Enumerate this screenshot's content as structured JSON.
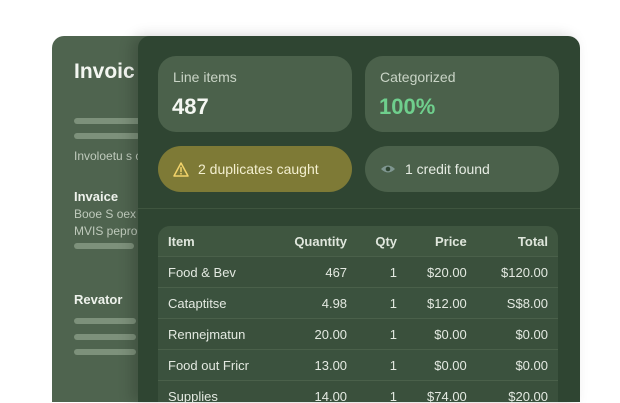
{
  "background_panel": {
    "title": "Invoic",
    "subtitle": "Involoetu s c",
    "section1_heading": "Invaice",
    "section1_line1": "Booe S oex",
    "section1_line2": "MVIS pepro",
    "section2_heading": "Revator"
  },
  "stats": {
    "line_items_label": "Line items",
    "line_items_value": "487",
    "categorized_label": "Categorized",
    "categorized_value": "100%",
    "accent_color": "#6fcf8d"
  },
  "alerts": {
    "duplicates_text": "2 duplicates caught",
    "duplicates_icon": "warning-icon",
    "credit_text": "1 credit found",
    "credit_icon": "eye-icon"
  },
  "table": {
    "headers": [
      "Item",
      "Quantity",
      "Qty",
      "Price",
      "Total"
    ],
    "rows": [
      [
        "Food & Bev",
        "467",
        "1",
        "$20.00",
        "$120.00"
      ],
      [
        "Cataptitse",
        "4.98",
        "1",
        "$12.00",
        "S$8.00"
      ],
      [
        "Rennejmatun",
        "20.00",
        "1",
        "$0.00",
        "$0.00"
      ],
      [
        "Food out Fricr",
        "13.00",
        "1",
        "$0.00",
        "$0.00"
      ],
      [
        "Supplies",
        "14.00",
        "1",
        "$74.00",
        "$20.00"
      ]
    ]
  }
}
